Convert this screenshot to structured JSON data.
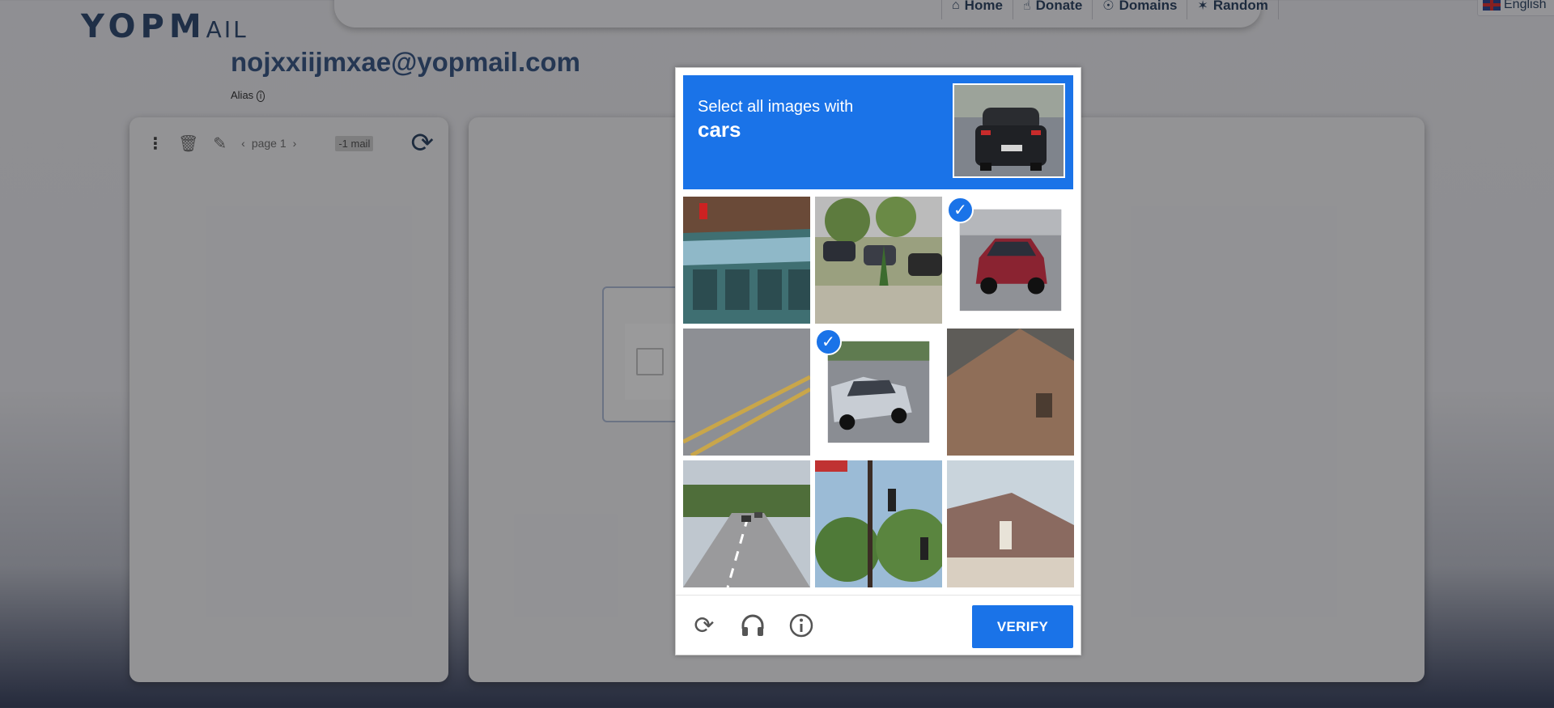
{
  "site": {
    "logo_main": "YOPM",
    "logo_tail": "AIL",
    "nav": [
      {
        "label": "Home",
        "icon": "home-icon",
        "glyph": "⌂"
      },
      {
        "label": "Donate",
        "icon": "thumbs-up-icon",
        "glyph": "👍"
      },
      {
        "label": "Domains",
        "icon": "globe-icon",
        "glyph": "⊕"
      },
      {
        "label": "Random",
        "icon": "magic-wand-icon",
        "glyph": "✶"
      }
    ],
    "language": "English",
    "email": "nojxxiijmxae@yopmail.com",
    "alias_label": "Alias",
    "mailbox": {
      "page_label": "page 1",
      "mail_count": "-1 mail"
    }
  },
  "captcha": {
    "instruction_line1": "Select all images with",
    "target": "cars",
    "verify_label": "VERIFY",
    "tiles": [
      {
        "desc": "bus",
        "selected": false
      },
      {
        "desc": "parking lot",
        "selected": false
      },
      {
        "desc": "red car",
        "selected": true
      },
      {
        "desc": "road markings",
        "selected": false
      },
      {
        "desc": "white car",
        "selected": true
      },
      {
        "desc": "roof",
        "selected": false
      },
      {
        "desc": "highway",
        "selected": false
      },
      {
        "desc": "traffic light",
        "selected": false
      },
      {
        "desc": "house",
        "selected": false
      }
    ],
    "footer_icons": [
      "reload-icon",
      "audio-icon",
      "info-icon"
    ],
    "colors": {
      "accent": "#1a73e8"
    }
  }
}
